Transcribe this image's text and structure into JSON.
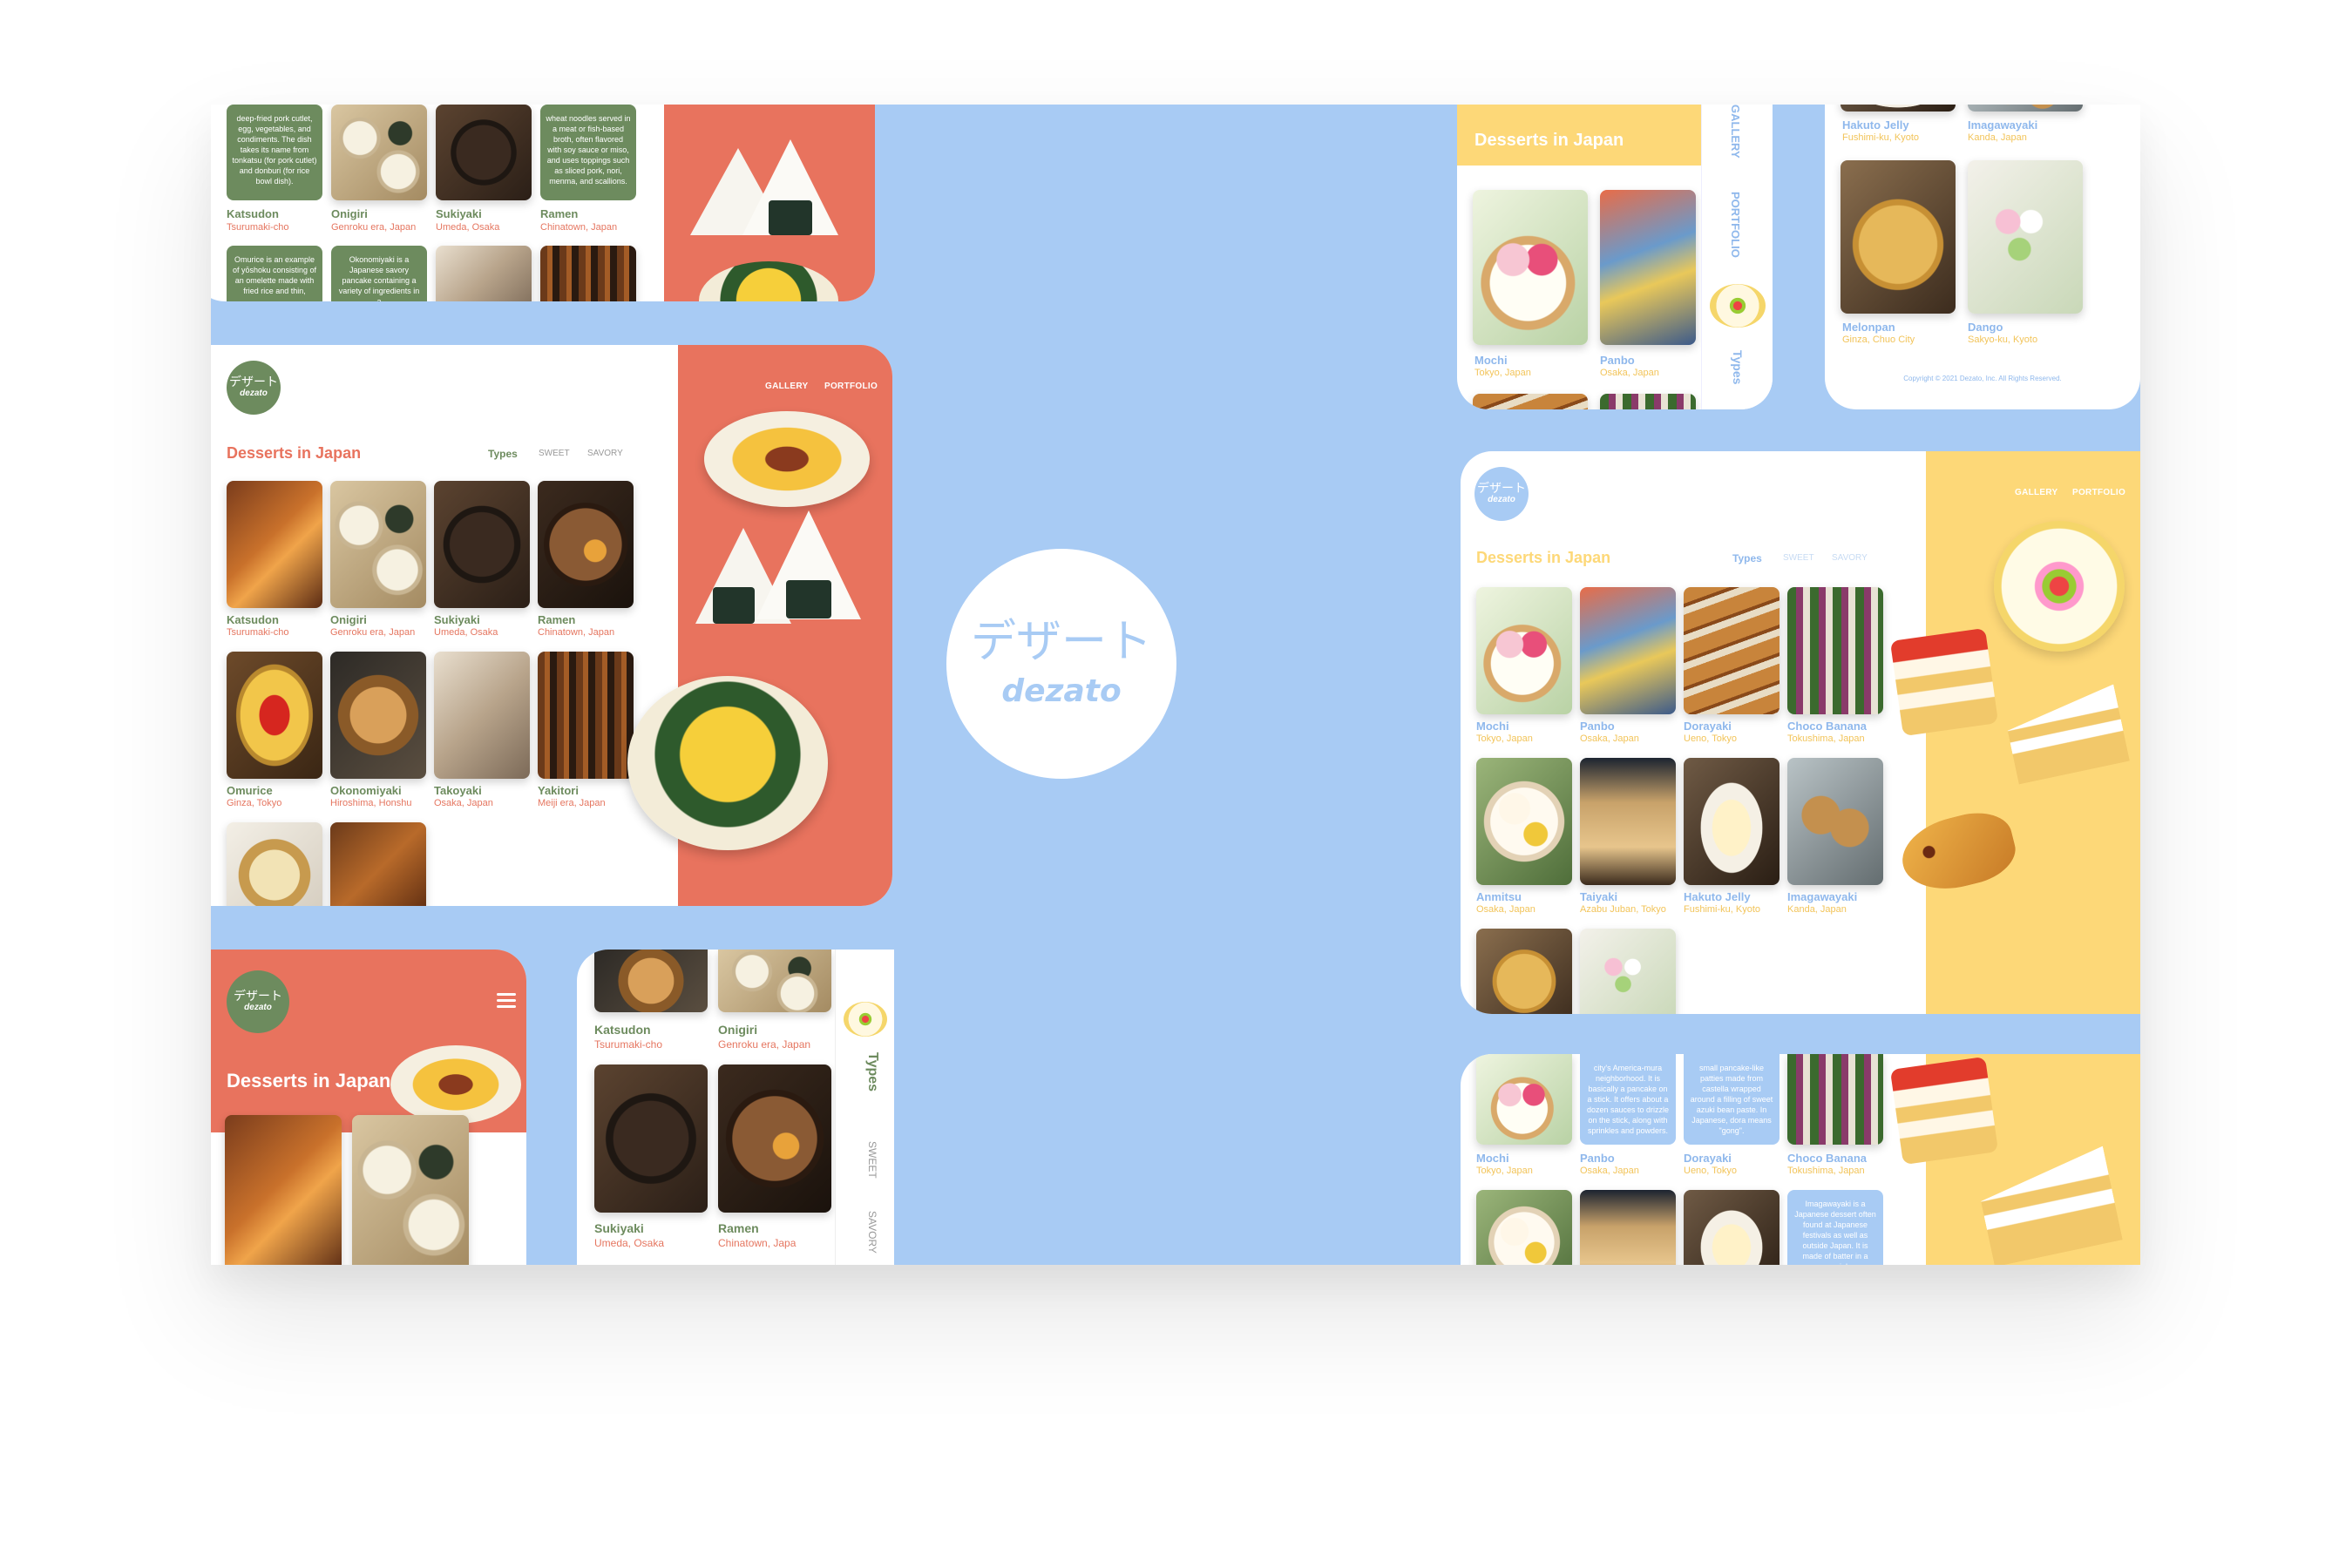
{
  "brand": {
    "jp": "デザート",
    "en": "dezato"
  },
  "nav": {
    "gallery": "GALLERY",
    "portfolio": "PORTFOLIO"
  },
  "filters": {
    "types": "Types",
    "sweet": "SWEET",
    "savory": "SAVORY"
  },
  "page_title": "Desserts in Japan",
  "copyright": "Copyright © 2021 Dezato, Inc. All Rights Reserved.",
  "savory_items": [
    {
      "name": "Katsudon",
      "place": "Tsurumaki-cho"
    },
    {
      "name": "Onigiri",
      "place": "Genroku era, Japan"
    },
    {
      "name": "Sukiyaki",
      "place": "Umeda, Osaka"
    },
    {
      "name": "Ramen",
      "place": "Chinatown, Japan"
    },
    {
      "name": "Omurice",
      "place": "Ginza, Tokyo"
    },
    {
      "name": "Okonomiyaki",
      "place": "Hiroshima, Honshu"
    },
    {
      "name": "Takoyaki",
      "place": "Osaka, Japan"
    },
    {
      "name": "Yakitori",
      "place": "Meiji era, Japan"
    }
  ],
  "mobile_savory": [
    {
      "name": "Katsudon",
      "place": "Tsurumaki-cho"
    },
    {
      "name": "Onigiri",
      "place": "Genroku era, Japan"
    },
    {
      "name": "Sukiyaki",
      "place": "Umeda, Osaka"
    },
    {
      "name": "Ramen",
      "place": "Chinatown, Japa"
    }
  ],
  "sweet_items": [
    {
      "name": "Mochi",
      "place": "Tokyo, Japan"
    },
    {
      "name": "Panbo",
      "place": "Osaka, Japan"
    },
    {
      "name": "Dorayaki",
      "place": "Ueno, Tokyo"
    },
    {
      "name": "Choco Banana",
      "place": "Tokushima, Japan"
    },
    {
      "name": "Anmitsu",
      "place": "Osaka, Japan"
    },
    {
      "name": "Taiyaki",
      "place": "Azabu Juban, Tokyo"
    },
    {
      "name": "Hakuto Jelly",
      "place": "Fushimi-ku, Kyoto"
    },
    {
      "name": "Imagawayaki",
      "place": "Kanda, Japan"
    }
  ],
  "sweet_top_right": [
    {
      "name": "Hakuto Jelly",
      "place": "Fushimi-ku, Kyoto"
    },
    {
      "name": "Imagawayaki",
      "place": "Kanda, Japan"
    },
    {
      "name": "Melonpan",
      "place": "Ginza, Chuo City"
    },
    {
      "name": "Dango",
      "place": "Sakyo-ku, Kyoto"
    }
  ],
  "savory_descriptions": {
    "katsudon": "deep-fried pork cutlet, egg, vegetables, and condiments. The dish takes its name from tonkatsu (for pork cutlet) and donburi (for rice bowl dish).",
    "ramen": "wheat noodles served in a meat or fish-based broth, often flavored with soy sauce or miso, and uses toppings such as sliced pork, nori, menma, and scallions.",
    "omurice": "Omurice is an example of yōshoku consisting of an omelette made with fried rice and thin,",
    "okonomiyaki": "Okonomiyaki is a Japanese savory pancake containing a variety of ingredients in a"
  },
  "sweet_descriptions": {
    "panbo": "city's America-mura neighborhood. It is basically a pancake on a stick. It offers about a dozen sauces to drizzle on the stick, along with sprinkles and powders.",
    "dorayaki": "small pancake-like patties made from castella wrapped around a filling of sweet azuki bean paste. In Japanese, dora means \"gong\".",
    "imagawayaki": "Imagawayaki is a Japanese dessert often found at Japanese festivals as well as outside Japan. It is made of batter in a special"
  },
  "colors": {
    "background": "#a8cbf4",
    "coral": "#e8735e",
    "green": "#6d8b5e",
    "yellow": "#fdd878",
    "blue": "#8fb8ec"
  }
}
